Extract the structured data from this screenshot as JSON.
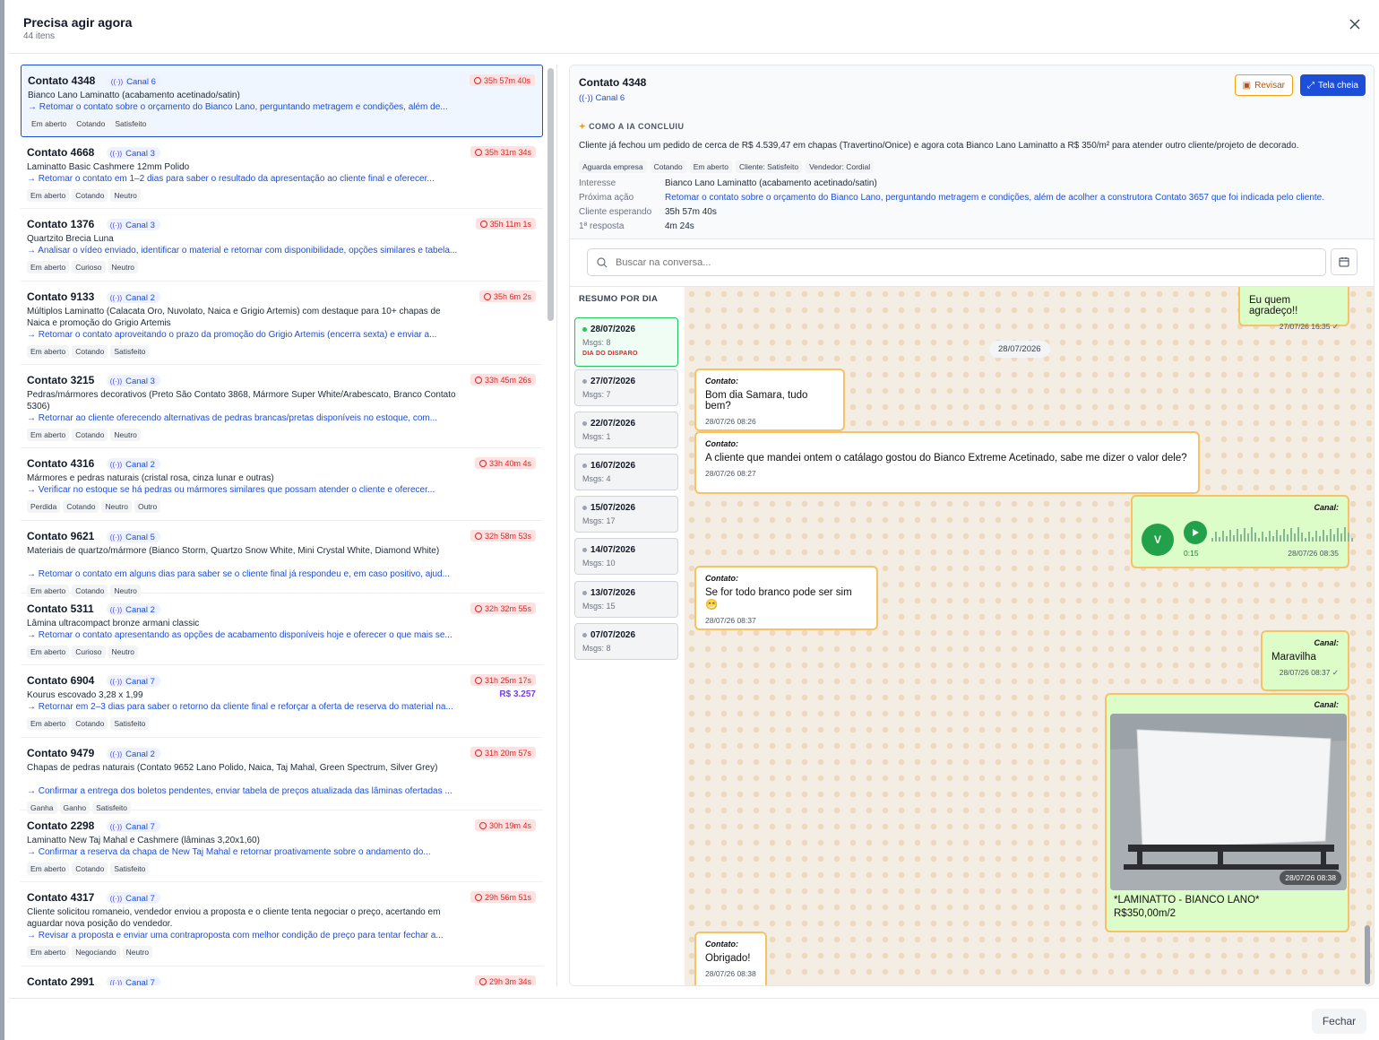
{
  "modal": {
    "title": "Precisa agir agora",
    "subtitle": "44 itens",
    "close_label": "Fechar"
  },
  "list": [
    {
      "name": "Contato 4348",
      "canal": "Canal 6",
      "timer": "35h 57m 40s",
      "desc": "Bianco Lano Laminatto (acabamento acetinado/satin)",
      "action": "→ Retomar o contato sobre o orçamento do Bianco Lano, perguntando metragem e condições, além de...",
      "tags": [
        "Em aberto",
        "Cotando",
        "Satisfeito"
      ]
    },
    {
      "name": "Contato 4668",
      "canal": "Canal 3",
      "timer": "35h 31m 34s",
      "desc": "Laminatto Basic Cashmere 12mm Polido",
      "action": "→ Retomar o contato em 1–2 dias para saber o resultado da apresentação ao cliente final e oferecer...",
      "tags": [
        "Em aberto",
        "Cotando",
        "Neutro"
      ]
    },
    {
      "name": "Contato 1376",
      "canal": "Canal 3",
      "timer": "35h 11m 1s",
      "desc": "Quartzito Brecia Luna",
      "action": "→ Analisar o vídeo enviado, identificar o material e retornar com disponibilidade, opções similares e tabela...",
      "tags": [
        "Em aberto",
        "Curioso",
        "Neutro"
      ]
    },
    {
      "name": "Contato 9133",
      "canal": "Canal 2",
      "timer": "35h 6m 2s",
      "desc": "Múltiplos Laminatto (Calacata Oro, Nuvolato, Naica e Grigio Artemis) com destaque para 10+ chapas de Naica e promoção do Grigio Artemis",
      "action": "→ Retomar o contato aproveitando o prazo da promoção do Grigio Artemis (encerra sexta) e enviar a...",
      "tags": [
        "Em aberto",
        "Cotando",
        "Satisfeito"
      ]
    },
    {
      "name": "Contato 3215",
      "canal": "Canal 3",
      "timer": "33h 45m 26s",
      "desc": "Pedras/mármores decorativos (Preto São Contato 3868, Mármore Super White/Arabescato, Branco Contato 5306)",
      "action": "→ Retornar ao cliente oferecendo alternativas de pedras brancas/pretas disponíveis no estoque, com...",
      "tags": [
        "Em aberto",
        "Cotando",
        "Neutro"
      ]
    },
    {
      "name": "Contato 4316",
      "canal": "Canal 2",
      "timer": "33h 40m 4s",
      "desc": "Mármores e pedras naturais (cristal rosa, cinza lunar e outras)",
      "action": "→ Verificar no estoque se há pedras ou mármores similares que possam atender o cliente e oferecer...",
      "tags": [
        "Perdida",
        "Cotando",
        "Neutro",
        "Outro"
      ]
    },
    {
      "name": "Contato 9621",
      "canal": "Canal 5",
      "timer": "32h 58m 53s",
      "desc": "Materiais de quartzo/mármore (Bianco Storm, Quartzo Snow White, Mini Crystal White, Diamond White)",
      "action": "→ Retomar o contato em alguns dias para saber se o cliente final já respondeu e, em caso positivo, ajud...",
      "tags": [
        "Em aberto",
        "Cotando",
        "Neutro"
      ]
    },
    {
      "name": "Contato 5311",
      "canal": "Canal 2",
      "timer": "32h 32m 55s",
      "desc": "Lâmina ultracompact bronze armani classic",
      "action": "→ Retomar o contato apresentando as opções de acabamento disponíveis hoje e oferecer o que mais se...",
      "tags": [
        "Em aberto",
        "Curioso",
        "Neutro"
      ]
    },
    {
      "name": "Contato 6904",
      "canal": "Canal 7",
      "timer": "31h 25m 17s",
      "price": "R$ 3.257",
      "desc": "Kourus escovado 3,28 x 1,99",
      "action": "→ Retornar em 2–3 dias para saber o retorno da cliente final e reforçar a oferta de reserva do material na...",
      "tags": [
        "Em aberto",
        "Cotando",
        "Satisfeito"
      ]
    },
    {
      "name": "Contato 9479",
      "canal": "Canal 2",
      "timer": "31h 20m 57s",
      "desc": "Chapas de pedras naturais (Contato 9652 Lano Polido, Naica, Taj Mahal, Green Spectrum, Silver Grey)",
      "action": "→ Confirmar a entrega dos boletos pendentes, enviar tabela de preços atualizada das lâminas ofertadas ...",
      "tags": [
        "Ganha",
        "Ganho",
        "Satisfeito"
      ]
    },
    {
      "name": "Contato 2298",
      "canal": "Canal 7",
      "timer": "30h 19m 4s",
      "desc": "Laminatto New Taj Mahal e Cashmere (lâminas 3,20x1,60)",
      "action": "→ Confirmar a reserva da chapa de New Taj Mahal e retornar proativamente sobre o andamento do...",
      "tags": [
        "Em aberto",
        "Cotando",
        "Satisfeito"
      ]
    },
    {
      "name": "Contato 4317",
      "canal": "Canal 7",
      "timer": "29h 56m 51s",
      "desc": "Cliente solicitou romaneio, vendedor enviou a proposta e o cliente tenta negociar o preço, acertando em aguardar nova posição do vendedor.",
      "action": "→ Revisar a proposta e enviar uma contraproposta com melhor condição de preço para tentar fechar a...",
      "tags": [
        "Em aberto",
        "Negociando",
        "Neutro"
      ]
    },
    {
      "name": "Contato 2991",
      "canal": "Canal 7",
      "timer": "29h 3m 34s",
      "desc": "",
      "action": "",
      "tags": []
    }
  ],
  "detail": {
    "name": "Contato 4348",
    "canal": "Canal 6",
    "revisar": "Revisar",
    "tela_cheia": "Tela cheia",
    "ia_header": "COMO A IA CONCLUIU",
    "ia_text": "Cliente já fechou um pedido de cerca de R$ 4.539,47 em chapas (Travertino/Onice) e agora cota Bianco Lano Laminatto a R$ 350/m² para atender outro cliente/projeto de decorado.",
    "ia_tags": [
      "Aguarda empresa",
      "Cotando",
      "Em aberto",
      "Cliente: Satisfeito",
      "Vendedor: Cordial"
    ],
    "kv": [
      {
        "k": "Interesse",
        "v": "Bianco Lano Laminatto (acabamento acetinado/satin)"
      },
      {
        "k": "Próxima ação",
        "v": "Retomar o contato sobre o orçamento do Bianco Lano, perguntando metragem e condições, além de acolher a construtora Contato 3657 que foi indicada pelo cliente."
      },
      {
        "k": "Cliente esperando",
        "v": "35h 57m 40s"
      },
      {
        "k": "1ª resposta",
        "v": "4m 24s"
      }
    ],
    "search_placeholder": "Buscar na conversa...",
    "days_header": "RESUMO POR DIA",
    "days": [
      {
        "date": "28/07/2026",
        "msgs": "Msgs: 8",
        "flag": "DIA DO DISPARO"
      },
      {
        "date": "27/07/2026",
        "msgs": "Msgs: 7"
      },
      {
        "date": "22/07/2026",
        "msgs": "Msgs: 1"
      },
      {
        "date": "16/07/2026",
        "msgs": "Msgs: 4"
      },
      {
        "date": "15/07/2026",
        "msgs": "Msgs: 17"
      },
      {
        "date": "14/07/2026",
        "msgs": "Msgs: 10"
      },
      {
        "date": "13/07/2026",
        "msgs": "Msgs: 15"
      },
      {
        "date": "07/07/2026",
        "msgs": "Msgs: 8"
      }
    ],
    "chat": {
      "top_msg": {
        "text": "Eu quem agradeço!!",
        "time": "27/07/26 16:35"
      },
      "date_chip": "28/07/2026",
      "msgs": [
        {
          "who": "Contato:",
          "text": "Bom dia Samara, tudo bem?",
          "time": "28/07/26 08:26"
        },
        {
          "who": "Contato:",
          "text": "A cliente que mandei ontem o catálago gostou do Bianco Extreme Acetinado, sabe me dizer o valor dele?",
          "time": "28/07/26 08:27"
        },
        {
          "who": "Canal:",
          "audio_avatar": "V",
          "audio_len": "0:15",
          "time": "28/07/26 08:35"
        },
        {
          "who": "Contato:",
          "text": "Se for todo branco pode ser sim 😁",
          "time": "28/07/26 08:37"
        },
        {
          "who": "Canal:",
          "text": "Maravilha",
          "time": "28/07/26 08:37"
        },
        {
          "who": "Canal:",
          "img_time": "28/07/26 08:38",
          "caption1": "*LAMINATTO - BIANCO LANO*",
          "caption2": "R$350,00m/2"
        },
        {
          "who": "Contato:",
          "text": "Obrigado!",
          "time": "28/07/26 08:38"
        }
      ]
    }
  }
}
